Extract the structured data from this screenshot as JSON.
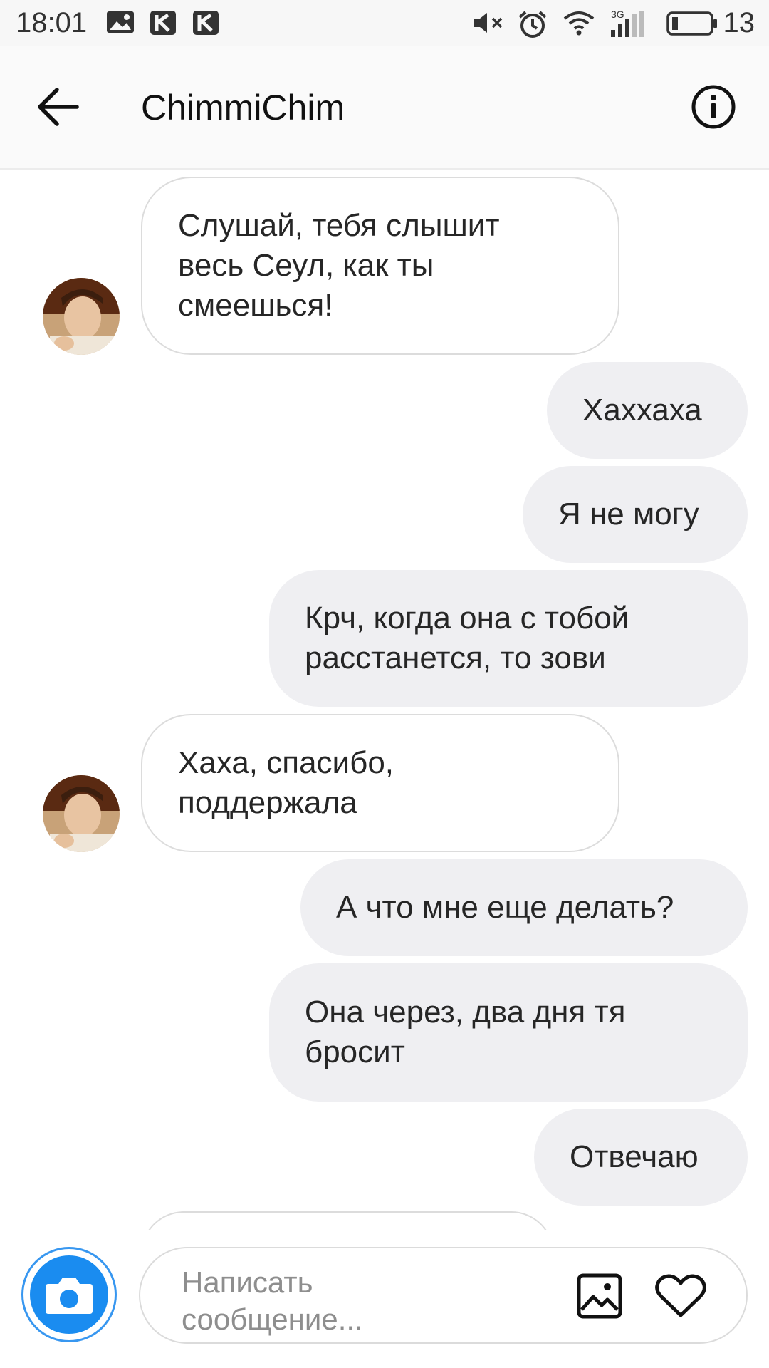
{
  "status_bar": {
    "time": "18:01",
    "battery": "13",
    "network": "3G",
    "icons": [
      "gallery-notification-icon",
      "k-app-icon",
      "k-app-icon",
      "mute-icon",
      "alarm-icon",
      "wifi-icon",
      "signal-icon",
      "battery-icon"
    ]
  },
  "header": {
    "title": "ChimmiChim",
    "back_icon": "arrow-left-icon",
    "info_icon": "info-circle-icon"
  },
  "messages": [
    {
      "direction": "incoming",
      "text": "Слушай, тебя слышит весь Сеул, как ты смеешься!",
      "lines": [
        "Слушай, тебя слышит",
        "весь Сеул, как ты",
        "смеешься!"
      ]
    },
    {
      "direction": "outgoing",
      "text": "Хаххаха",
      "lines": [
        "Хаххаха"
      ]
    },
    {
      "direction": "outgoing",
      "text": "Я не могу",
      "lines": [
        "Я не могу"
      ]
    },
    {
      "direction": "outgoing",
      "text": "Крч, когда она с тобой расстанется, то зови",
      "lines": [
        "Крч, когда она с тобой",
        "расстанется, то зови"
      ]
    },
    {
      "direction": "incoming",
      "text": "Хаха, спасибо, поддержала",
      "lines": [
        "Хаха, спасибо,",
        "поддержала"
      ]
    },
    {
      "direction": "outgoing",
      "text": "А что мне еще делать?",
      "lines": [
        "А что мне еще делать?"
      ]
    },
    {
      "direction": "outgoing",
      "text": "Она через, два дня тя бросит",
      "lines": [
        "Она через, два дня тя",
        "бросит"
      ]
    },
    {
      "direction": "outgoing",
      "text": "Отвечаю",
      "lines": [
        "Отвечаю"
      ]
    }
  ],
  "composer": {
    "placeholder_lines": [
      "Написать",
      "сообщение..."
    ],
    "camera_icon": "camera-icon",
    "gallery_icon": "gallery-icon",
    "like_icon": "heart-icon"
  },
  "colors": {
    "accent": "#3897f0",
    "incoming_bg": "#ffffff",
    "outgoing_bg": "#efeff2",
    "text": "#262626",
    "placeholder": "#8e8e8e"
  }
}
